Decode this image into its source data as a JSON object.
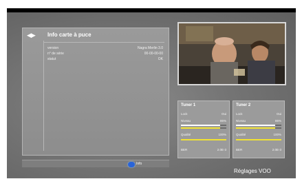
{
  "colors": {
    "signal_bar": "#f1e232",
    "quality_bar": "#f1e232",
    "level_bar": "#ffffff",
    "blue_button": "#2a64d8"
  },
  "card_panel": {
    "nav_icon": "left-right-arrows-icon",
    "title": "Info carte à puce",
    "rows": [
      {
        "label": "version",
        "value": "Nagra Merlin 3.0"
      },
      {
        "label": "n° de série",
        "value": "00-00-00-00"
      },
      {
        "label": "statut",
        "value": "OK"
      }
    ]
  },
  "footer": {
    "blue_button_label": "Info"
  },
  "tuners": [
    {
      "title": "Tuner 1",
      "lock_label": "Lock",
      "lock_value": "Oui",
      "level_label": "Niveau",
      "level_value": "86%",
      "level_pct": 0.86,
      "quality_label": "Qualité",
      "quality_value": "100%",
      "quality_pct": 1.0,
      "ber_label": "BER",
      "ber_value": "2.0E-3"
    },
    {
      "title": "Tuner 2",
      "lock_label": "Lock",
      "lock_value": "Oui",
      "level_label": "Niveau",
      "level_value": "86%",
      "level_pct": 0.86,
      "quality_label": "Qualité",
      "quality_value": "100%",
      "quality_pct": 1.0,
      "ber_label": "BER",
      "ber_value": "2.0E-3"
    }
  ],
  "brand_text": "Réglages VOO"
}
